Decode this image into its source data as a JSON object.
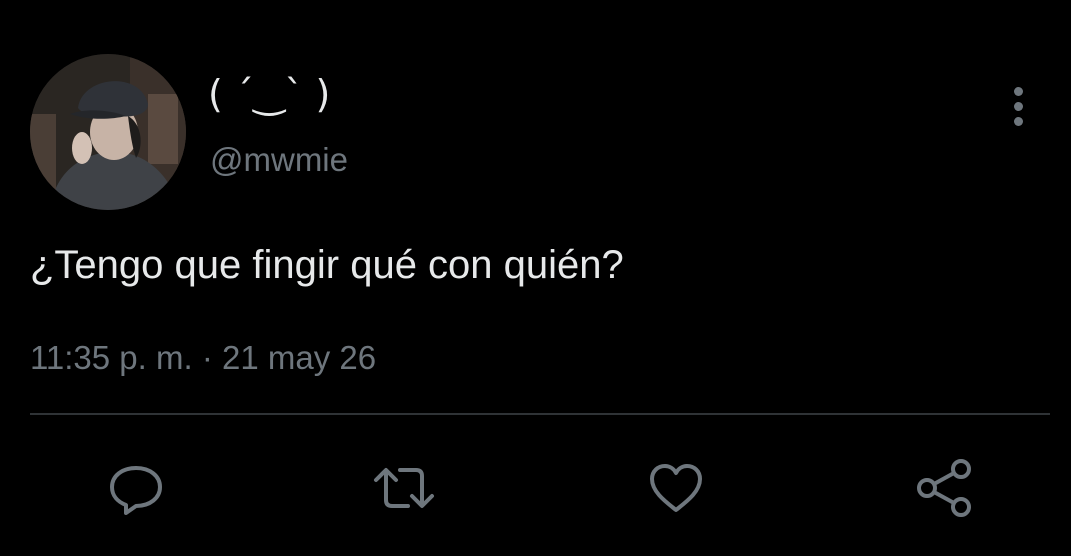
{
  "user": {
    "display_name": "( ˊ‿ˋ )",
    "handle": "@mwmie",
    "avatar_icon": "profile-photo"
  },
  "tweet": {
    "text": "¿Tengo que fingir qué con quién?",
    "timestamp": "11:35 p. m. · 21 may 26"
  },
  "actions": {
    "reply_icon": "speech-bubble",
    "retweet_icon": "retweet-arrows",
    "like_icon": "heart",
    "share_icon": "share-nodes",
    "more_icon": "vertical-dots"
  },
  "colors": {
    "background": "#000000",
    "primary_text": "#e7e9ea",
    "secondary_text": "#6e767d",
    "divider": "#2f3336"
  }
}
